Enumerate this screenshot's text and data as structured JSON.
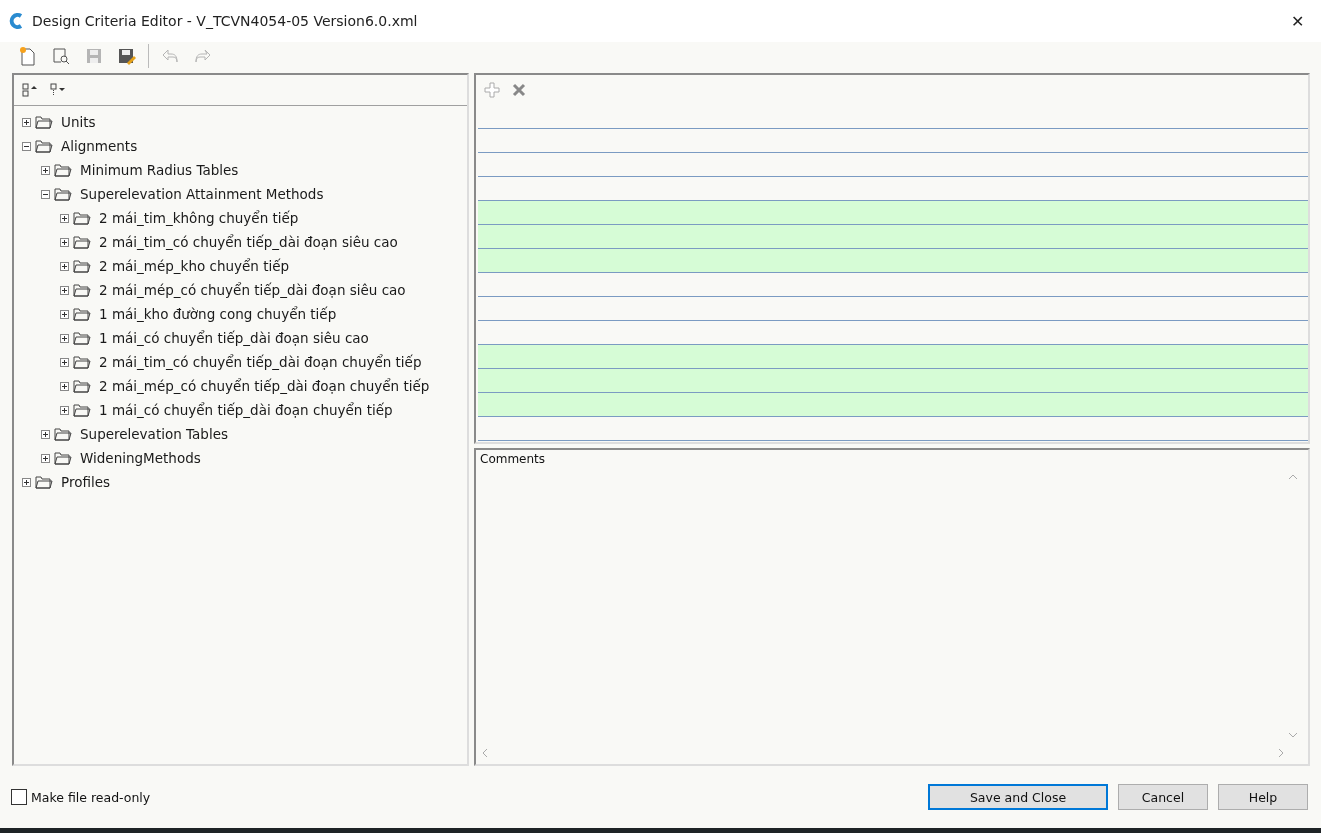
{
  "window": {
    "title": "Design Criteria Editor - V_TCVN4054-05 Version6.0.xml",
    "close": "✕"
  },
  "toolbar": [
    {
      "kind": "new",
      "disabled": false
    },
    {
      "kind": "open",
      "disabled": false
    },
    {
      "kind": "save",
      "disabled": true
    },
    {
      "kind": "saveas",
      "disabled": false
    },
    {
      "kind": "undo",
      "disabled": true
    },
    {
      "kind": "redo",
      "disabled": true
    }
  ],
  "tree": {
    "items": [
      {
        "label": "Units",
        "expanded": false
      },
      {
        "label": "Alignments",
        "expanded": true,
        "children": [
          {
            "label": "Minimum Radius Tables",
            "expanded": false
          },
          {
            "label": "Superelevation Attainment Methods",
            "expanded": true,
            "children": [
              {
                "label": "2 mái_tim_không chuyển tiếp",
                "expanded": false
              },
              {
                "label": "2 mái_tim_có chuyển tiếp_dài đoạn siêu cao",
                "expanded": false
              },
              {
                "label": "2 mái_mép_kho chuyển tiếp",
                "expanded": false
              },
              {
                "label": "2 mái_mép_có chuyển tiếp_dài đoạn siêu cao",
                "expanded": false
              },
              {
                "label": "1 mái_kho đường cong chuyển tiếp",
                "expanded": false
              },
              {
                "label": "1 mái_có chuyển tiếp_dài đoạn siêu cao",
                "expanded": false
              },
              {
                "label": "2 mái_tim_có chuyển tiếp_dài đoạn chuyển tiếp",
                "expanded": false
              },
              {
                "label": "2 mái_mép_có chuyển tiếp_dài đoạn chuyển tiếp",
                "expanded": false
              },
              {
                "label": "1 mái_có chuyển tiếp_dài đoạn chuyển tiếp",
                "expanded": false
              }
            ]
          },
          {
            "label": "Superelevation Tables",
            "expanded": false
          },
          {
            "label": "WideningMethods",
            "expanded": false
          }
        ]
      },
      {
        "label": "Profiles",
        "expanded": false
      }
    ]
  },
  "grid": {
    "add_disabled": true,
    "rows": [
      {
        "highlighted": false
      },
      {
        "highlighted": false
      },
      {
        "highlighted": false
      },
      {
        "highlighted": false
      },
      {
        "highlighted": true
      },
      {
        "highlighted": true
      },
      {
        "highlighted": true
      },
      {
        "highlighted": false
      },
      {
        "highlighted": false
      },
      {
        "highlighted": false
      },
      {
        "highlighted": true
      },
      {
        "highlighted": true
      },
      {
        "highlighted": true
      },
      {
        "highlighted": false
      }
    ]
  },
  "comments": {
    "label": "Comments"
  },
  "footer": {
    "readonly": {
      "label": "Make file read-only",
      "checked": false
    },
    "buttons": [
      {
        "label": "Save and Close",
        "default": true
      },
      {
        "label": "Cancel",
        "default": false
      },
      {
        "label": "Help",
        "default": false
      }
    ]
  }
}
